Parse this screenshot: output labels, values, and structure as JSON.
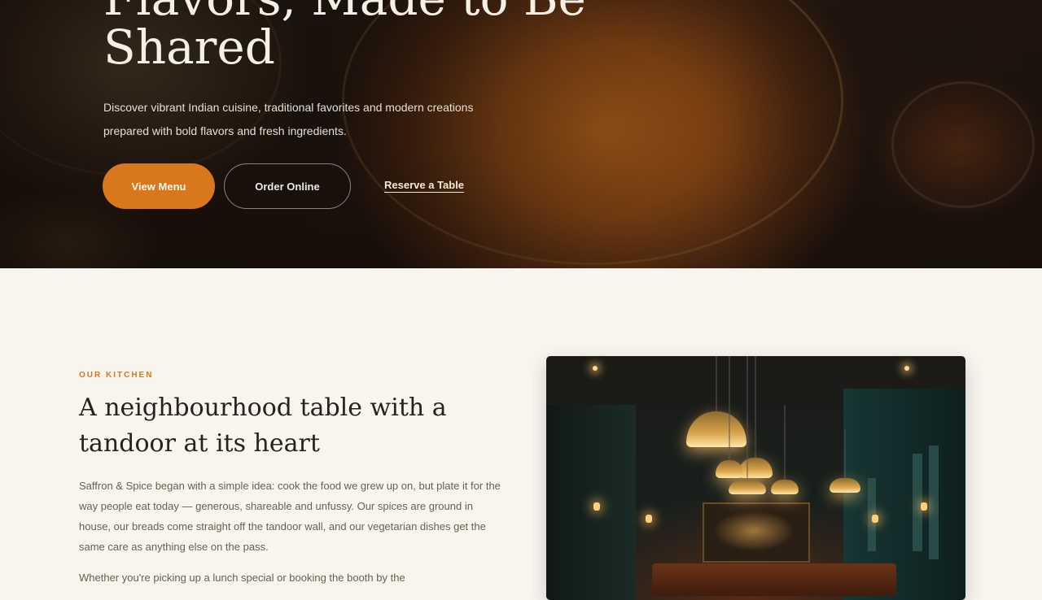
{
  "hero": {
    "title": "Flavors, Made to Be Shared",
    "subtitle": "Discover vibrant Indian cuisine, traditional favorites and modern creations prepared with bold flavors and fresh ingredients.",
    "primary_button": "View Menu",
    "secondary_button": "Order Online",
    "reserve_link": "Reserve a Table"
  },
  "kitchen": {
    "eyebrow": "OUR KITCHEN",
    "title": "A neighbourhood table with a tandoor at its heart",
    "paragraph1": "Saffron & Spice began with a simple idea: cook the food we grew up on, but plate it for the way people eat today — generous, shareable and unfussy. Our spices are ground in house, our breads come straight off the tandoor wall, and our vegetarian dishes get the same care as anything else on the pass.",
    "paragraph2": "Whether you're picking up a lunch special or booking the booth by the"
  },
  "colors": {
    "accent": "#d9771c",
    "background": "#f8f5ef",
    "hero_dark": "#1e140e",
    "heading": "#2b2119"
  }
}
